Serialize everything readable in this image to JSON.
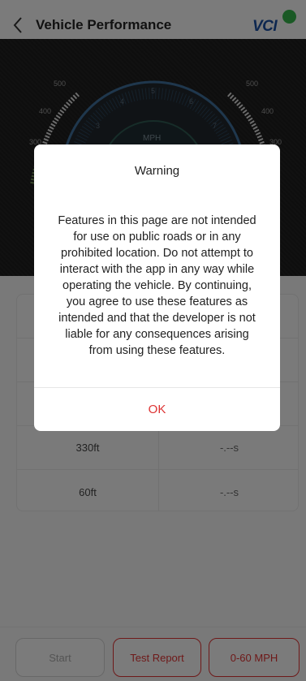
{
  "header": {
    "title": "Vehicle Performance",
    "logo_text": "VCI"
  },
  "gauge": {
    "unit": "MPH",
    "outer_labels": [
      "500",
      "400",
      "300",
      "500",
      "400",
      "300"
    ],
    "dial_labels": [
      "3",
      "4",
      "5",
      "6",
      "7"
    ]
  },
  "results": {
    "rows": [
      {
        "distance": "",
        "time": ""
      },
      {
        "distance": "",
        "time": ""
      },
      {
        "distance": "",
        "time": ""
      },
      {
        "distance": "330ft",
        "time": "-.--s"
      },
      {
        "distance": "60ft",
        "time": "-.--s"
      }
    ]
  },
  "bottom": {
    "start_label": "Start",
    "report_label": "Test Report",
    "mode_label": "0-60 MPH"
  },
  "dialog": {
    "title": "Warning",
    "body": "Features in this page are not intended for use on public roads or in any prohibited location. Do not attempt to interact with the app in any way while operating the vehicle.  By continuing, you agree to use these features as intended and that the developer is not liable for any consequences arising from using these features.",
    "ok_label": "OK"
  },
  "colors": {
    "accent": "#dd3333",
    "brand": "#1a4fa0",
    "badge": "#34b24a"
  }
}
